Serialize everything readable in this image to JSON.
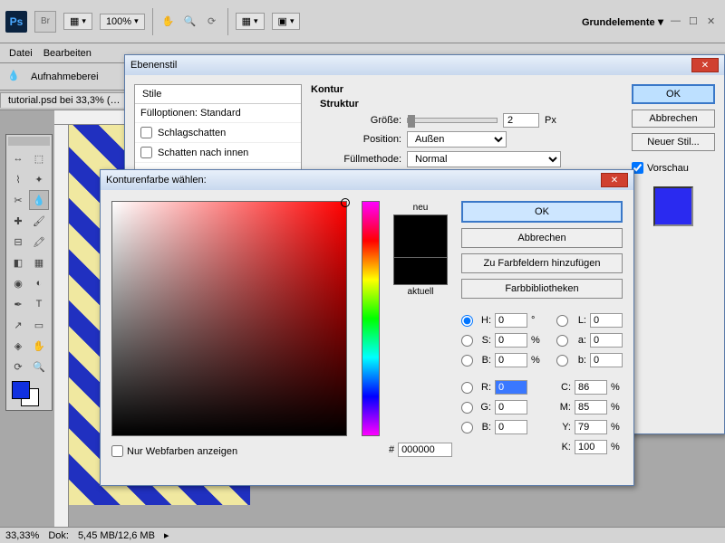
{
  "topbar": {
    "zoom": "100%",
    "workspace": "Grundelemente"
  },
  "menubar": {
    "file": "Datei",
    "edit": "Bearbeiten"
  },
  "options": {
    "sample_label": "Aufnahmeberei"
  },
  "doc_tab": "tutorial.psd bei 33,3% (…",
  "status": {
    "zoom": "33,33%",
    "doc_label": "Dok:",
    "doc_size": "5,45 MB/12,6 MB"
  },
  "layerstyle": {
    "title": "Ebenenstil",
    "styles_header": "Stile",
    "blend_opts": "Fülloptionen: Standard",
    "effects": [
      "Schlagschatten",
      "Schatten nach innen"
    ],
    "section": "Kontur",
    "struct": "Struktur",
    "size_label": "Größe:",
    "size_value": "2",
    "size_unit": "Px",
    "position_label": "Position:",
    "position_value": "Außen",
    "blend_label": "Füllmethode:",
    "blend_value": "Normal",
    "ok": "OK",
    "cancel": "Abbrechen",
    "newstyle": "Neuer Stil...",
    "preview": "Vorschau"
  },
  "picker": {
    "title": "Konturenfarbe wählen:",
    "new": "neu",
    "current": "aktuell",
    "ok": "OK",
    "cancel": "Abbrechen",
    "add_swatch": "Zu Farbfeldern hinzufügen",
    "libraries": "Farbbibliotheken",
    "H": "0",
    "S": "0",
    "Bhsb": "0",
    "R": "0",
    "G": "0",
    "Brgb": "0",
    "L": "0",
    "a": "0",
    "blab": "0",
    "C": "86",
    "M": "85",
    "Y": "79",
    "K": "100",
    "hex": "000000",
    "web_only": "Nur Webfarben anzeigen"
  }
}
